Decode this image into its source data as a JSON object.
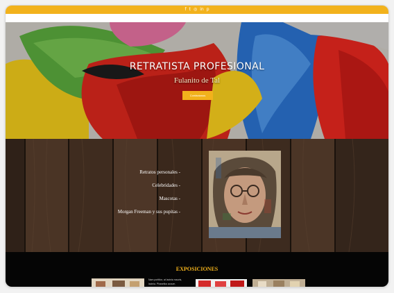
{
  "social": {
    "icons": [
      "facebook-icon",
      "twitter-icon",
      "instagram-icon",
      "linkedin-icon",
      "pinterest-icon"
    ],
    "glyphs": [
      "f",
      "t",
      "◎",
      "in",
      "p"
    ]
  },
  "hero": {
    "title": "RETRATISTA PROFESIONAL",
    "subtitle": "Fulanito de Tal",
    "button_label": "Contáctanos"
  },
  "services": {
    "items": [
      "Retratos personales -",
      "Celebridades -",
      "Mascotas -",
      "Morgan Freeman y sus pupitas -"
    ]
  },
  "exhibitions": {
    "title": "EXPOSICIONES",
    "text_lines": [
      "Nam porttitor, at lacinia mauris,",
      "lacinia. Phasellus accum."
    ]
  },
  "colors": {
    "accent": "#f2b21c",
    "wood": "#3a2a1f",
    "black": "#050505"
  }
}
